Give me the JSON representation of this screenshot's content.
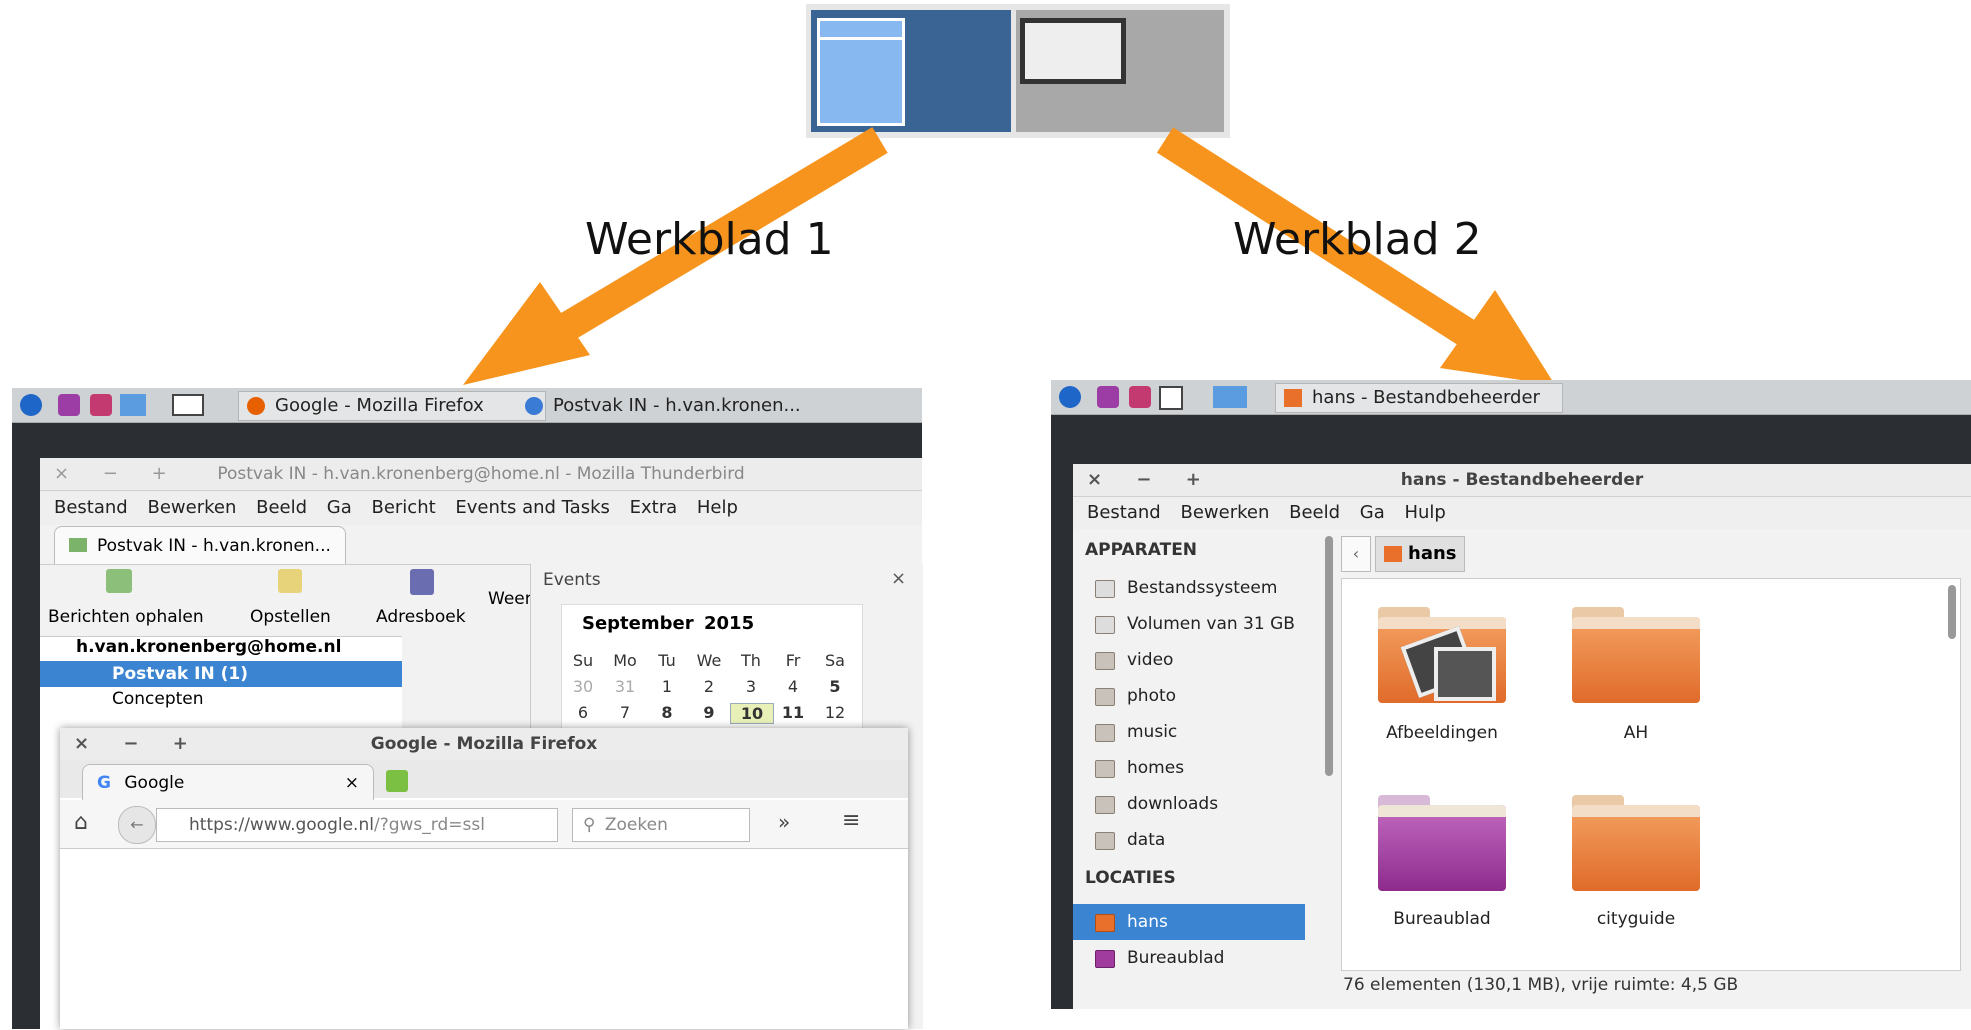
{
  "labels": {
    "ws1": "Werkblad 1",
    "ws2": "Werkblad 2"
  },
  "colors": {
    "arrow": "#f7941d",
    "pager_active": "#3a6494",
    "selection": "#3b84d1"
  },
  "left": {
    "tasks": [
      "Google - Mozilla Firefox",
      "Postvak IN - h.van.kronen..."
    ],
    "thunderbird": {
      "title": "Postvak IN - h.van.kronenberg@home.nl - Mozilla Thunderbird",
      "menu": [
        "Bestand",
        "Bewerken",
        "Beeld",
        "Ga",
        "Bericht",
        "Events and Tasks",
        "Extra",
        "Help"
      ],
      "tab": "Postvak IN - h.van.kronen...",
      "toolbar": [
        "Berichten ophalen",
        "Opstellen",
        "Adresboek",
        "Weerg"
      ],
      "account": "h.van.kronenberg@home.nl",
      "folders": [
        "Postvak IN (1)",
        "Concepten"
      ],
      "events_title": "Events",
      "cal_month": "September",
      "cal_year": "2015",
      "cal_days": [
        "Su",
        "Mo",
        "Tu",
        "We",
        "Th",
        "Fr",
        "Sa"
      ],
      "cal_row1": [
        "30",
        "31",
        "1",
        "2",
        "3",
        "4",
        "5"
      ],
      "cal_row2": [
        "6",
        "7",
        "8",
        "9",
        "10",
        "11",
        "12"
      ]
    },
    "firefox": {
      "title": "Google - Mozilla Firefox",
      "tab": "Google",
      "url_host": "https://www.google.nl",
      "url_path": "/?gws_rd=ssl",
      "search_placeholder": "Zoeken"
    }
  },
  "right": {
    "tasks": [
      "hans - Bestandbeheerder"
    ],
    "fm": {
      "title": "hans - Bestandbeheerder",
      "menu": [
        "Bestand",
        "Bewerken",
        "Beeld",
        "Ga",
        "Hulp"
      ],
      "sec_devices": "APPARATEN",
      "devices": [
        "Bestandssysteem",
        "Volumen van 31 GB",
        "video",
        "photo",
        "music",
        "homes",
        "downloads",
        "data"
      ],
      "sec_places": "LOCATIES",
      "places": [
        "hans",
        "Bureaublad"
      ],
      "path": "hans",
      "files": [
        "Afbeeldingen",
        "AH",
        "Bureaublad",
        "cityguide"
      ],
      "status": "76 elementen (130,1 MB), vrije ruimte: 4,5 GB"
    }
  }
}
